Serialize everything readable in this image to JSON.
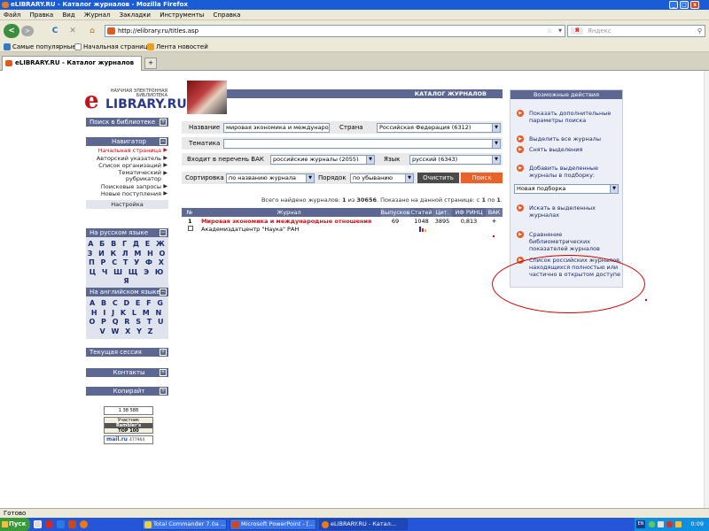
{
  "window": {
    "title": "eLIBRARY.RU - Каталог журналов - Mozilla Firefox",
    "buttons": [
      "_",
      "□",
      "x"
    ]
  },
  "menu": [
    "Файл",
    "Правка",
    "Вид",
    "Журнал",
    "Закладки",
    "Инструменты",
    "Справка"
  ],
  "nav": {
    "back": "<",
    "forward": ">",
    "reload": "C",
    "stop": "✕",
    "home": "⌂",
    "url": "http://elibrary.ru/titles.asp",
    "star": "☆",
    "search_placeholder": "Яндекс",
    "search_engine_label": "Я"
  },
  "bookmarks": [
    "Самые популярные",
    "Начальная страница",
    "Лента новостей"
  ],
  "tabs": [
    {
      "label": "eLIBRARY.RU - Каталог журналов"
    }
  ],
  "tab_add": "+",
  "logo": {
    "tagline": "НАУЧНАЯ ЭЛЕКТРОННАЯ БИБЛИОТЕКА",
    "letter": "e",
    "name": "LIBRARY.RU"
  },
  "sidebar": {
    "search_header": "Поиск в библиотеке",
    "nav_header": "Навигатор",
    "nav_items": [
      {
        "label": "Начальная страница",
        "active": true
      },
      {
        "label": "Авторский указатель"
      },
      {
        "label": "Список организаций"
      },
      {
        "label": "Тематический рубрикатор"
      },
      {
        "label": "Поисковые запросы"
      },
      {
        "label": "Новые поступления"
      },
      {
        "label": "Настройка"
      }
    ],
    "ru_header": "На русском языке",
    "ru_rows": [
      "А Б В Г Д Е Ж",
      "З И К Л М Н О",
      "П Р С Т У Ф Х",
      "Ц Ч Ш Щ Э Ю Я"
    ],
    "en_header": "На английском языке",
    "en_rows": [
      "A B C D E F G",
      "H I J K L M N",
      "O P Q R S T U",
      "V W X Y Z"
    ],
    "session_header": "Текущая сессия",
    "contacts_header": "Контакты",
    "copyright_header": "Копирайт",
    "counter_top": "1 38 588",
    "counter_rambler_label": "Участник",
    "counter_rambler": "Rambler's",
    "counter_top100": "TOP 100",
    "counter_mail": "mail.ru",
    "counter_mail_num": "477964"
  },
  "catalog": {
    "title": "КАТАЛОГ ЖУРНАЛОВ",
    "filter": {
      "name_label": "Название",
      "name_value": "мировая экономика и международны",
      "country_label": "Страна",
      "country_value": "Российская Федерация  (6312)",
      "theme_label": "Тематика",
      "theme_value": "",
      "vak_label": "Входит в перечень ВАК",
      "vak_value": "российские журналы  (2055)",
      "lang_label": "Язык",
      "lang_value": "русский  (6343)",
      "sort_label": "Сортировка",
      "sort_value": "по названию журнала",
      "order_label": "Порядок",
      "order_value": "по убыванию",
      "clear_label": "Очистить",
      "search_label": "Поиск"
    },
    "summary": {
      "found_label": "Всего найдено журналов:",
      "found_num": "1",
      "of_label": "из",
      "total": "30656",
      "shown_label": ". Показано на данной странице: с",
      "from": "1",
      "to_label": "по",
      "to": "1"
    },
    "columns": [
      "№",
      "Журнал",
      "Выпусков",
      "Статей",
      "Цит.",
      "ИФ РИНЦ",
      "ВАК"
    ],
    "rows": [
      {
        "num": "1",
        "title": "Мировая экономика и международные отношения",
        "publisher": "Академиздатцентр \"Наука\" РАН",
        "issues": "69",
        "articles": "1048",
        "citations": "3895",
        "impact": "0,813",
        "vak": "+"
      }
    ]
  },
  "actions": {
    "header": "Возможные действия",
    "items": [
      "Показать дополнительные параметры поиска",
      "Выделить все журналы",
      "Снять выделения",
      "Добавить выделенные журналы в подборку:",
      "Искать в выделенных журналах",
      "Сравнение библиометрических показателей журналов",
      "Список российских журналов, находящихся полностью или частично в открытом доступе"
    ],
    "collection_value": "Новая подборка"
  },
  "status": "Готово",
  "taskbar": {
    "start": "Пуск",
    "tasks": [
      {
        "label": "Total Commander 7.0а ..."
      },
      {
        "label": "Microsoft PowerPoint - [..."
      },
      {
        "label": "eLIBRARY.RU - Катал...",
        "active": true
      }
    ],
    "lang": "EN",
    "clock": "0:09"
  }
}
